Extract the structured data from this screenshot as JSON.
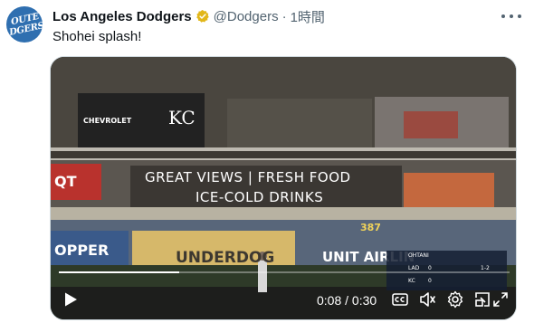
{
  "account": {
    "name": "Los Angeles Dodgers",
    "handle": "@Dodgers",
    "separator": "·",
    "time": "1時間",
    "verified": true,
    "avatar_text_line1": "OUTE",
    "avatar_text_line2": "DGERS"
  },
  "tweet": {
    "text": "Shohei splash!"
  },
  "video": {
    "current_time": "0:08",
    "duration": "0:30",
    "progress": 0.267,
    "scene_signs": {
      "sponsor1": "CHEVROLET",
      "sponsor2": "KC",
      "banner_line1": "GREAT VIEWS | FRESH FOOD",
      "banner_line2": "ICE-COLD DRINKS",
      "distance": "387",
      "underdog": "UNDERDOG",
      "left_ad": "OPPER",
      "right_ad": "UNIT AIRLIN",
      "qt": "QT"
    },
    "scorebug": {
      "batter": "OHTANI",
      "team1": "LAD",
      "score1": "0",
      "team2": "KC",
      "score2": "0",
      "inning": "1-2"
    }
  },
  "colors": {
    "accent": "#1d9bf0",
    "text": "#0f1419",
    "secondary": "#536471"
  },
  "icons": {
    "verified": "verified-badge-icon",
    "more": "more-icon",
    "play": "play-icon",
    "captions": "captions-icon",
    "volume": "volume-icon",
    "settings": "gear-icon",
    "pip": "picture-in-picture-icon",
    "fullscreen": "fullscreen-icon"
  }
}
